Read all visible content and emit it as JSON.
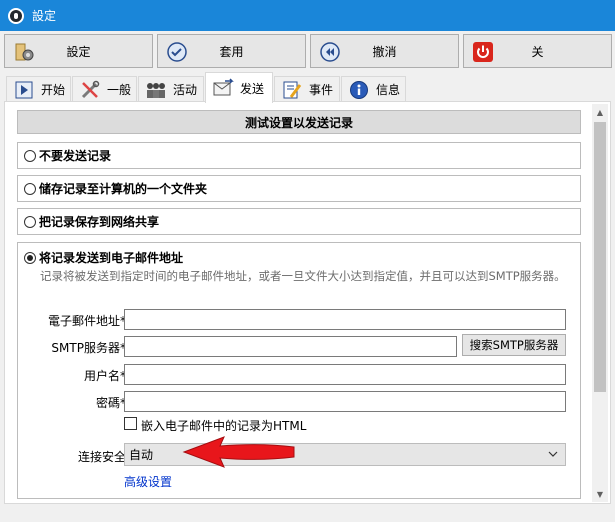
{
  "window": {
    "title": "設定"
  },
  "toolbar": {
    "settings_label": "設定",
    "apply_label": "套用",
    "undo_label": "撤消",
    "close_label": "关"
  },
  "tabs": [
    {
      "label": "开始",
      "icon": "play-icon"
    },
    {
      "label": "一般",
      "icon": "tools-icon"
    },
    {
      "label": "活动",
      "icon": "people-icon"
    },
    {
      "label": "发送",
      "icon": "mail-icon",
      "active": true
    },
    {
      "label": "事件",
      "icon": "edit-icon"
    },
    {
      "label": "信息",
      "icon": "info-icon"
    }
  ],
  "panel": {
    "header": "测试设置以发送记录",
    "options": {
      "no_send": "不要发送记录",
      "save_folder": "储存记录至计算机的一个文件夹",
      "save_network": "把记录保存到网络共享",
      "send_email": "将记录发送到电子邮件地址"
    },
    "email": {
      "description": "记录将被发送到指定时间的电子邮件地址，或者一旦文件大小达到指定值，并且可以达到SMTP服务器。",
      "address_label": "電子郵件地址*:",
      "address_value": "",
      "smtp_label": "SMTP服务器*:",
      "smtp_value": "",
      "search_smtp_label": "搜索SMTP服务器",
      "username_label": "用户名*:",
      "username_value": "",
      "password_label": "密碼*:",
      "password_value": "",
      "embed_html_label": "嵌入电子邮件中的记录为HTML",
      "embed_html_checked": false,
      "security_label": "连接安全:",
      "security_value": "自动",
      "advanced_link": "高级设置"
    }
  },
  "colors": {
    "titlebar": "#1a86d9",
    "annotation_arrow": "#e8161b",
    "link": "#0033cc"
  }
}
